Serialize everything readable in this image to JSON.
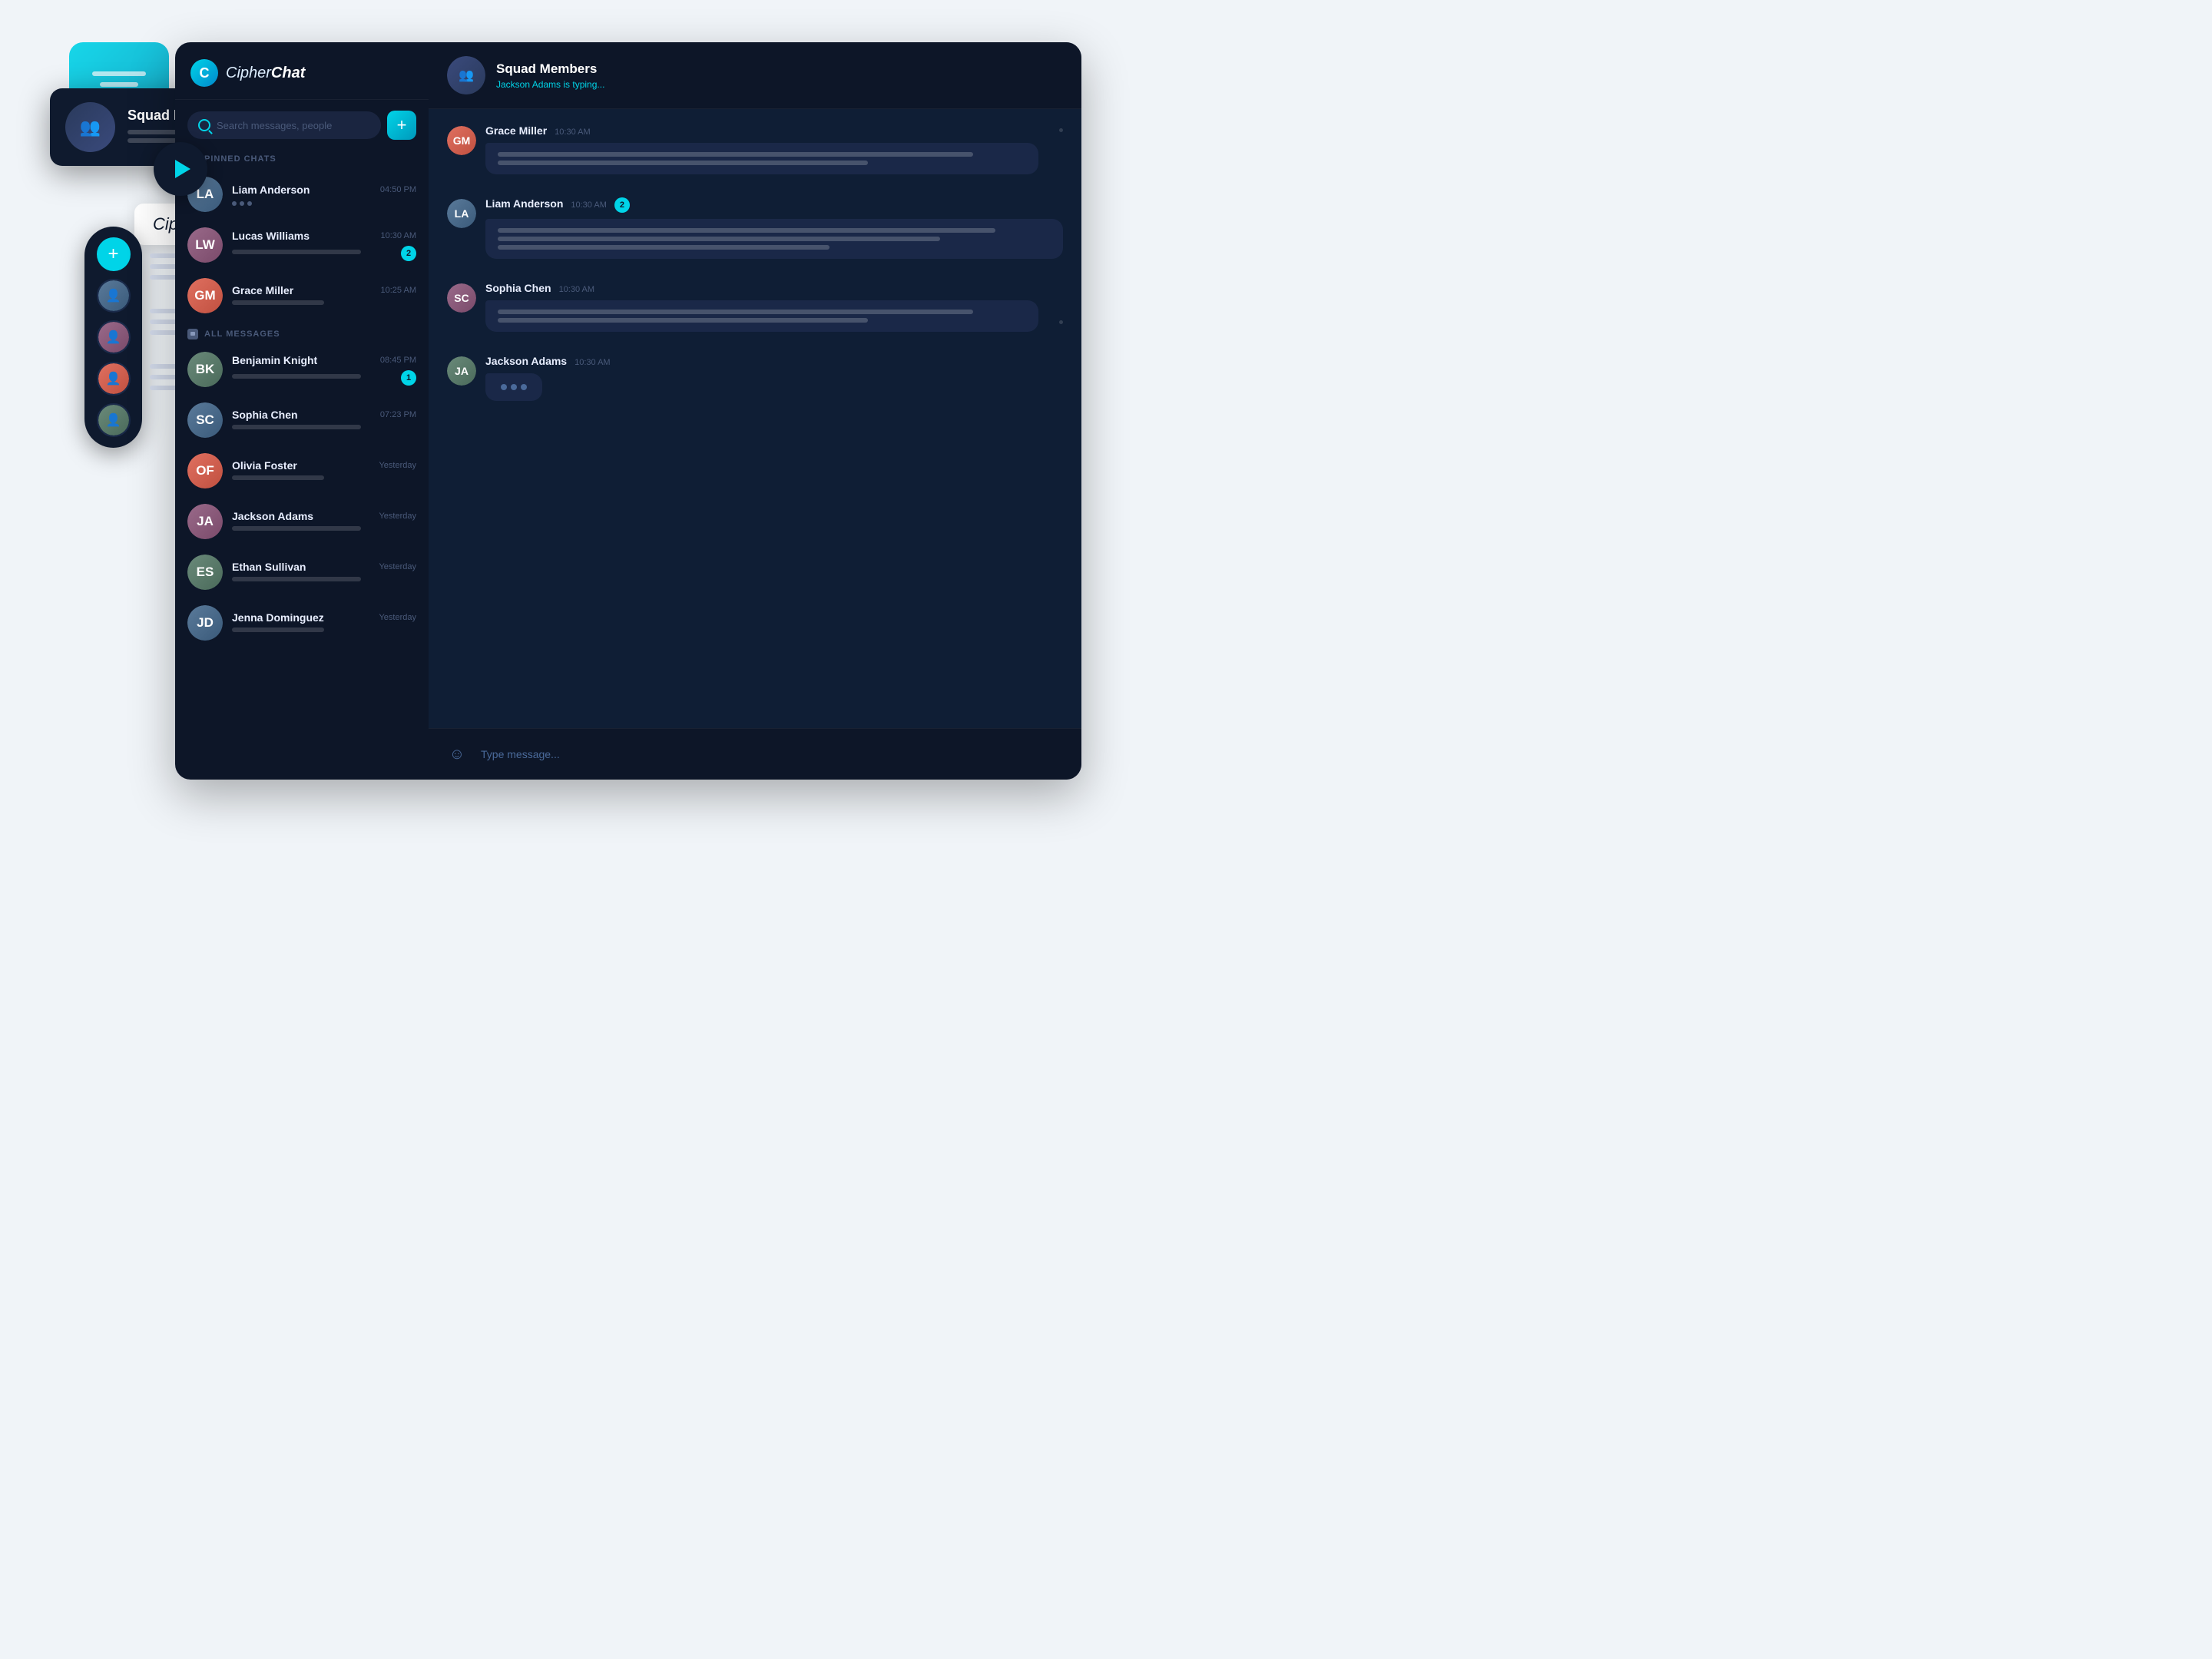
{
  "app": {
    "logo_text_regular": "Cipher",
    "logo_text_italic": "Chat",
    "logo_char": "C"
  },
  "search": {
    "placeholder": "Search messages, people"
  },
  "sections": {
    "pinned_chats": "PINNED CHATS",
    "all_messages": "ALL MESSAGES"
  },
  "pinned_chats": [
    {
      "name": "Liam Anderson",
      "time": "04:50 PM",
      "avatar_initials": "LA",
      "avatar_color": "ac1",
      "has_typing": true
    },
    {
      "name": "Lucas Williams",
      "time": "10:30 AM",
      "avatar_initials": "LW",
      "avatar_color": "ac2",
      "badge": "2"
    },
    {
      "name": "Grace Miller",
      "time": "10:25 AM",
      "avatar_initials": "GM",
      "avatar_color": "ac3",
      "has_reply": true
    }
  ],
  "all_messages": [
    {
      "name": "Benjamin Knight",
      "time": "08:45 PM",
      "avatar_initials": "BK",
      "avatar_color": "ac4",
      "badge": "1"
    },
    {
      "name": "Sophia Chen",
      "time": "07:23 PM",
      "avatar_initials": "SC",
      "avatar_color": "ac1"
    },
    {
      "name": "Olivia Foster",
      "time": "Yesterday",
      "avatar_initials": "OF",
      "avatar_color": "ac3",
      "has_reply": true
    },
    {
      "name": "Jackson Adams",
      "time": "Yesterday",
      "avatar_initials": "JA",
      "avatar_color": "ac2"
    },
    {
      "name": "Ethan Sullivan",
      "time": "Yesterday",
      "avatar_initials": "ES",
      "avatar_color": "ac4"
    },
    {
      "name": "Jenna Dominguez",
      "time": "Yesterday",
      "avatar_initials": "JD",
      "avatar_color": "ac1"
    }
  ],
  "chat_window": {
    "group_name": "Squad Members",
    "typing_status": "Jackson Adams is typing...",
    "messages": [
      {
        "sender": "Grace Miller",
        "time": "10:30 AM",
        "avatar_initials": "GM",
        "avatar_color": "ac3",
        "lines": [
          "w90",
          "w70"
        ]
      },
      {
        "sender": "Liam Anderson",
        "time": "10:30 AM",
        "avatar_initials": "LA",
        "avatar_color": "ac1",
        "badge": "2",
        "lines": [
          "w90",
          "w80",
          "w60"
        ]
      },
      {
        "sender": "Sophia Chen",
        "time": "10:30 AM",
        "avatar_initials": "SC",
        "avatar_color": "ac2",
        "lines": [
          "w90",
          "w70"
        ]
      },
      {
        "sender": "Jackson Adams",
        "time": "10:30 AM",
        "avatar_initials": "JA",
        "avatar_color": "ac4",
        "is_typing": true
      }
    ]
  },
  "message_input": {
    "placeholder": "Type message..."
  },
  "squad_card": {
    "name": "Squad Members"
  },
  "contacts_pill": {
    "add_label": "+"
  },
  "cipher_logo_card": {
    "text": "CipherChat"
  }
}
